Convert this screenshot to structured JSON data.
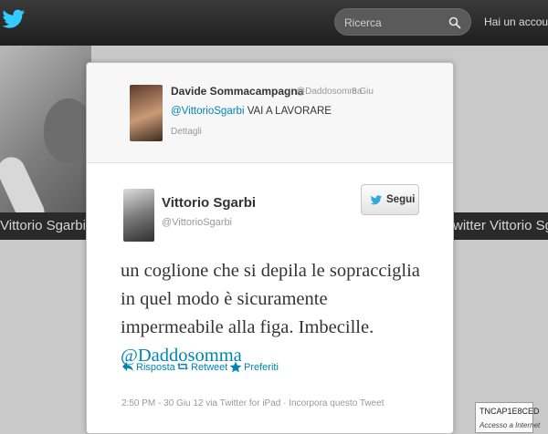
{
  "topbar": {
    "search_placeholder": "Ricerca",
    "account_link": "Hai un account? A"
  },
  "background": {
    "band_left": "Vittorio Sgarbi @ T",
    "band_right": "witter Vittorio Sgarbi"
  },
  "reply": {
    "name": "Davide Sommacampagna",
    "handle": "@Daddosomma",
    "date": "8 Giu",
    "mention": "@VittorioSgarbi",
    "text": " VAI A LAVORARE",
    "details": "Dettagli"
  },
  "tweet": {
    "author_name": "Vittorio Sgarbi",
    "author_handle": "@VittorioSgarbi",
    "follow_label": "Segui",
    "text_before": "un coglione che si depila le sopracciglia in quel modo è sicuramente impermeabile alla figa. Imbecille. ",
    "mention": "@Daddosomma",
    "actions": {
      "reply": "Risposta",
      "retweet": "Retweet",
      "favorite": "Preferiti"
    },
    "meta": "2:50 PM - 30 Giu 12 via Twitter for iPad · Incorpora questo Tweet"
  },
  "badge": {
    "code": "TNCAP1E8CED",
    "sub": "Accesso a Internet"
  },
  "colors": {
    "link": "#0084b4",
    "topbar": "#2b2b2b",
    "twitter_blue": "#33ccff"
  }
}
